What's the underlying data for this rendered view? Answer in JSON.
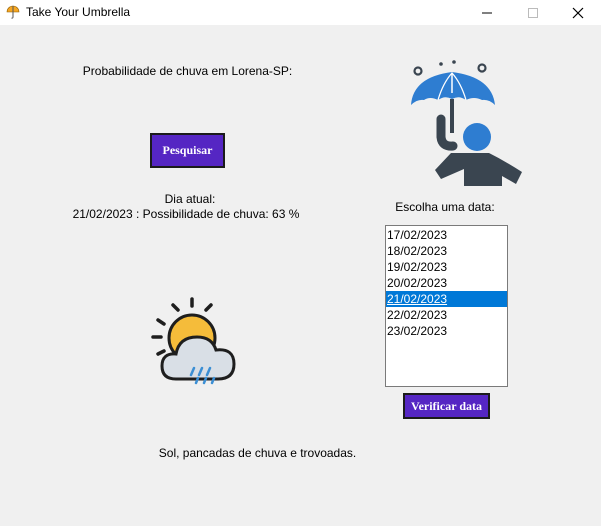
{
  "window": {
    "title": "Take Your Umbrella",
    "minimize_symbol": "—",
    "maximize_symbol": "☐",
    "close_symbol": "✕"
  },
  "main": {
    "prob_label": "Probabilidade de chuva em Lorena-SP:",
    "search_button": "Pesquisar",
    "current_day_label": "Dia atual:",
    "current_result": "21/02/2023 : Possibilidade de chuva: 63 %",
    "weather_description": "Sol, pancadas de chuva e trovoadas."
  },
  "date_picker": {
    "label": "Escolha uma data:",
    "dates": [
      "17/02/2023",
      "18/02/2023",
      "19/02/2023",
      "20/02/2023",
      "21/02/2023",
      "22/02/2023",
      "23/02/2023"
    ],
    "selected": "21/02/2023",
    "verify_button": "Verificar data"
  },
  "icons": {
    "app": "umbrella-app-icon",
    "person": "person-with-umbrella-icon",
    "weather": "sun-cloud-rain-icon"
  },
  "colors": {
    "button_bg": "#5526c3",
    "selection": "#0078d7",
    "umbrella_blue": "#2e7dd1",
    "figure_dark": "#3a4550",
    "sun_yellow": "#f5bc3a"
  }
}
